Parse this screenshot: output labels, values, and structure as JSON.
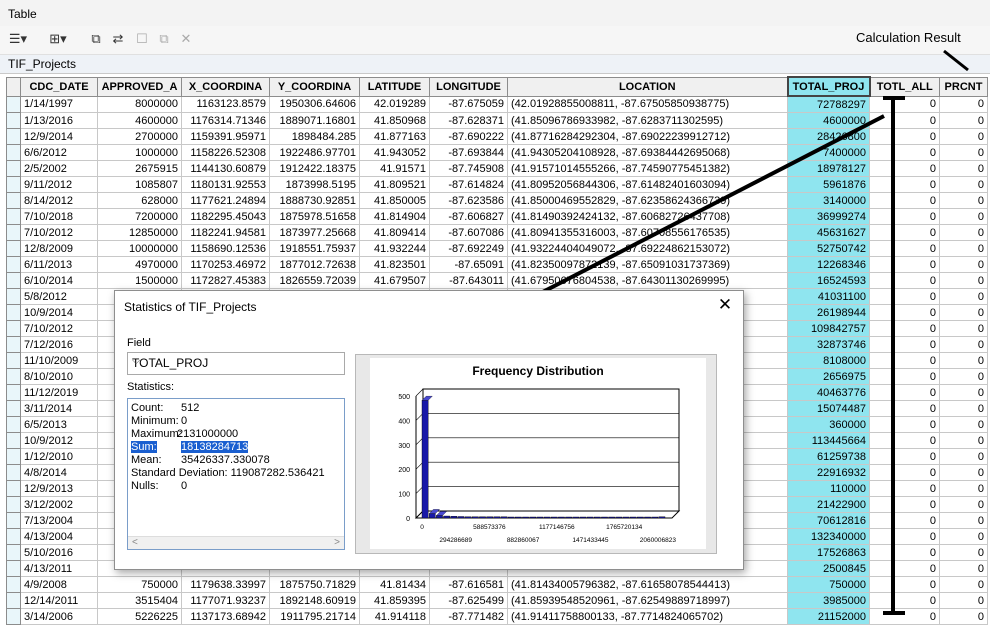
{
  "window": {
    "title": "Table"
  },
  "toolbar": {
    "annotation": "Calculation Result"
  },
  "table": {
    "name": "TIF_Projects",
    "columns": [
      "",
      "CDC_DATE",
      "APPROVED_A",
      "X_COORDINA",
      "Y_COORDINA",
      "LATITUDE",
      "LONGITUDE",
      "LOCATION",
      "TOTAL_PROJ",
      "TOTL_ALL",
      "PRCNT"
    ],
    "rows": [
      [
        "1/14/1997",
        "8000000",
        "1163123.8579",
        "1950306.64606",
        "42.019289",
        "-87.675059",
        "(42.01928855008811, -87.67505850938775)",
        "72788297",
        "0",
        "0"
      ],
      [
        "1/13/2016",
        "4600000",
        "1176314.71346",
        "1889071.16801",
        "41.850968",
        "-87.628371",
        "(41.85096786933982, -87.6283711302595)",
        "4600000",
        "0",
        "0"
      ],
      [
        "12/9/2014",
        "2700000",
        "1159391.95971",
        "1898484.285",
        "41.877163",
        "-87.690222",
        "(41.87716284292304, -87.69022239912712)",
        "28426800",
        "0",
        "0"
      ],
      [
        "6/6/2012",
        "1000000",
        "1158226.52308",
        "1922486.97701",
        "41.943052",
        "-87.693844",
        "(41.94305204108928, -87.69384442695068)",
        "7400000",
        "0",
        "0"
      ],
      [
        "2/5/2002",
        "2675915",
        "1144130.60879",
        "1912422.18375",
        "41.91571",
        "-87.745908",
        "(41.91571014555266, -87.74590775451382)",
        "18978127",
        "0",
        "0"
      ],
      [
        "9/11/2012",
        "1085807",
        "1180131.92553",
        "1873998.5195",
        "41.809521",
        "-87.614824",
        "(41.80952056844306, -87.61482401603094)",
        "5961876",
        "0",
        "0"
      ],
      [
        "8/14/2012",
        "628000",
        "1177621.24894",
        "1888730.92851",
        "41.850005",
        "-87.623586",
        "(41.85000469552829, -87.62358624366739)",
        "3140000",
        "0",
        "0"
      ],
      [
        "7/10/2018",
        "7200000",
        "1182295.45043",
        "1875978.51658",
        "41.814904",
        "-87.606827",
        "(41.81490392424132, -87.60682726437708)",
        "36999274",
        "0",
        "0"
      ],
      [
        "7/10/2012",
        "12850000",
        "1182241.94581",
        "1873977.25668",
        "41.809414",
        "-87.607086",
        "(41.80941355316003, -87.60708556176535)",
        "45631627",
        "0",
        "0"
      ],
      [
        "12/8/2009",
        "10000000",
        "1158690.12536",
        "1918551.75937",
        "41.932244",
        "-87.692249",
        "(41.93224404049072, -87.69224862153072)",
        "52750742",
        "0",
        "0"
      ],
      [
        "6/11/2013",
        "4970000",
        "1170253.46972",
        "1877012.72638",
        "41.823501",
        "-87.65091",
        "(41.82350097872139, -87.65091031737369)",
        "12268346",
        "0",
        "0"
      ],
      [
        "6/10/2014",
        "1500000",
        "1172827.45383",
        "1826559.72039",
        "41.679507",
        "-87.643011",
        "(41.67950676804538, -87.64301130269995)",
        "16524593",
        "0",
        "0"
      ],
      [
        "5/8/2012",
        "",
        "",
        "",
        "",
        "",
        "",
        "41031100",
        "0",
        "0"
      ],
      [
        "10/9/2014",
        "",
        "",
        "",
        "",
        "",
        "",
        "26198944",
        "0",
        "0"
      ],
      [
        "7/10/2012",
        "",
        "",
        "",
        "",
        "",
        "",
        "109842757",
        "0",
        "0"
      ],
      [
        "7/12/2016",
        "",
        "",
        "",
        "",
        "",
        "",
        "32873746",
        "0",
        "0"
      ],
      [
        "11/10/2009",
        "",
        "",
        "",
        "",
        "",
        "",
        "8108000",
        "0",
        "0"
      ],
      [
        "8/10/2010",
        "",
        "",
        "",
        "",
        "",
        "",
        "2656975",
        "0",
        "0"
      ],
      [
        "11/12/2019",
        "",
        "",
        "",
        "",
        "",
        "",
        "40463776",
        "0",
        "0"
      ],
      [
        "3/11/2014",
        "",
        "",
        "",
        "",
        "",
        "",
        "15074487",
        "0",
        "0"
      ],
      [
        "6/5/2013",
        "",
        "",
        "",
        "",
        "",
        "",
        "360000",
        "0",
        "0"
      ],
      [
        "10/9/2012",
        "",
        "",
        "",
        "",
        "",
        "",
        "113445664",
        "0",
        "0"
      ],
      [
        "1/12/2010",
        "",
        "",
        "",
        "",
        "",
        "",
        "61259738",
        "0",
        "0"
      ],
      [
        "4/8/2014",
        "",
        "",
        "",
        "",
        "",
        "",
        "22916932",
        "0",
        "0"
      ],
      [
        "12/9/2013",
        "",
        "",
        "",
        "",
        "",
        "",
        "110000",
        "0",
        "0"
      ],
      [
        "3/12/2002",
        "",
        "",
        "",
        "",
        "",
        "",
        "21422900",
        "0",
        "0"
      ],
      [
        "7/13/2004",
        "",
        "",
        "",
        "",
        "",
        "",
        "70612816",
        "0",
        "0"
      ],
      [
        "4/13/2004",
        "",
        "",
        "",
        "",
        "",
        "",
        "132340000",
        "0",
        "0"
      ],
      [
        "5/10/2016",
        "",
        "",
        "",
        "",
        "",
        "",
        "17526863",
        "0",
        "0"
      ],
      [
        "4/13/2011",
        "",
        "",
        "",
        "",
        "",
        "",
        "2500845",
        "0",
        "0"
      ],
      [
        "4/9/2008",
        "750000",
        "1179638.33997",
        "1875750.71829",
        "41.81434",
        "-87.616581",
        "(41.81434005796382, -87.61658078544413)",
        "750000",
        "0",
        "0"
      ],
      [
        "12/14/2011",
        "3515404",
        "1177071.93237",
        "1892148.60919",
        "41.859395",
        "-87.625499",
        "(41.85939548520961, -87.62549889718997)",
        "3985000",
        "0",
        "0"
      ],
      [
        "3/14/2006",
        "5226225",
        "1137173.68942",
        "1911795.21714",
        "41.914118",
        "-87.771482",
        "(41.91411758800133, -87.7714824065702)",
        "21152000",
        "0",
        "0"
      ]
    ]
  },
  "dialog": {
    "title": "Statistics of TIF_Projects",
    "close": "✕",
    "field_label": "Field",
    "field_value": "TOTAL_PROJ",
    "stats_label": "Statistics:",
    "stats": [
      {
        "label": "Count:",
        "value": "512"
      },
      {
        "label": "Minimum:",
        "value": "0"
      },
      {
        "label": "Maximum:",
        "value": "2131000000"
      },
      {
        "label": "Sum:",
        "value": "18138284713"
      },
      {
        "label": "Mean:",
        "value": "35426337.330078"
      },
      {
        "label": "Standard Deviation:",
        "value": "119087282.536421"
      },
      {
        "label": "Nulls:",
        "value": "0"
      }
    ]
  },
  "chart_data": {
    "type": "bar",
    "title": "Frequency Distribution",
    "xlabel": "",
    "ylabel": "",
    "ylim": [
      0,
      500
    ],
    "yticks": [
      "0",
      "100",
      "200",
      "300",
      "400",
      "500"
    ],
    "xticks_top": [
      "0",
      "588573376",
      "1177146756",
      "1765720134"
    ],
    "xticks_bottom": [
      "294286689",
      "882860067",
      "1471433445",
      "2060006823"
    ],
    "values": [
      478,
      14,
      6,
      4,
      3,
      2,
      1,
      1,
      1,
      1,
      1,
      1,
      0,
      0,
      0,
      0,
      0,
      0,
      0,
      0,
      0,
      0,
      0,
      0,
      0,
      0,
      0,
      0,
      0,
      0,
      0,
      0,
      0,
      1
    ],
    "bar_color": "#1818a8"
  }
}
